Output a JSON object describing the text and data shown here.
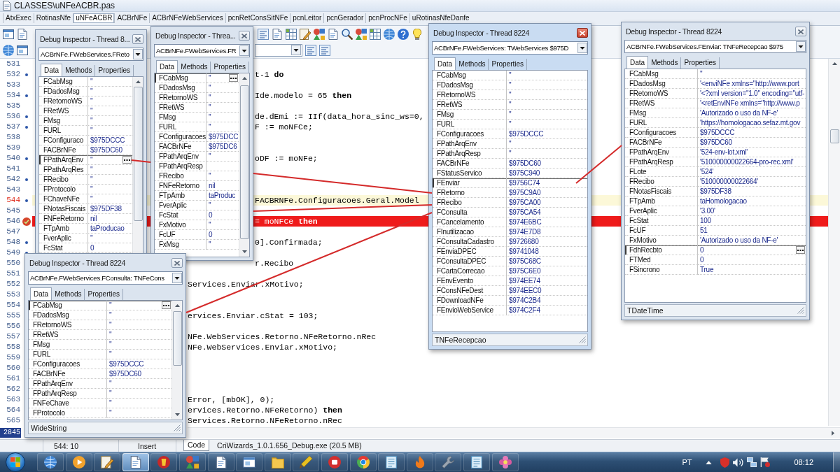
{
  "window": {
    "title": "CLASSES\\uNFeACBR.pas"
  },
  "file_tabs": [
    {
      "label": "AtxExec",
      "selected": false
    },
    {
      "label": "RotinasNfe",
      "selected": false
    },
    {
      "label": "uNFeACBR",
      "selected": true
    },
    {
      "label": "ACBrNFe",
      "selected": false
    },
    {
      "label": "ACBrNFeWebServices",
      "selected": false
    },
    {
      "label": "pcnRetConsSitNFe",
      "selected": false
    },
    {
      "label": "pcnLeitor",
      "selected": false
    },
    {
      "label": "pcnGerador",
      "selected": false
    },
    {
      "label": "pcnProcNFe",
      "selected": false
    },
    {
      "label": "uRotinasNfeDanfe",
      "selected": false
    }
  ],
  "editor": {
    "lines": [
      {
        "number": "531",
        "executable": false,
        "breakpoint": false,
        "current": false
      },
      {
        "number": "532",
        "executable": true,
        "breakpoint": false,
        "current": false,
        "text": "t-1 **do**"
      },
      {
        "number": "533",
        "executable": false,
        "breakpoint": false,
        "current": false
      },
      {
        "number": "534",
        "executable": true,
        "breakpoint": false,
        "current": false,
        "text": "Ide.modelo = 65 **then**"
      },
      {
        "number": "535",
        "executable": false,
        "breakpoint": false,
        "current": false
      },
      {
        "number": "536",
        "executable": true,
        "breakpoint": false,
        "current": false,
        "text": "de.dEmi := IIf(data_hora_sinc_ws=0,"
      },
      {
        "number": "537",
        "executable": true,
        "breakpoint": false,
        "current": false,
        "text": "F := moNFCe;"
      },
      {
        "number": "538",
        "executable": false,
        "breakpoint": false,
        "current": false
      },
      {
        "number": "539",
        "executable": false,
        "breakpoint": false,
        "current": false
      },
      {
        "number": "540",
        "executable": true,
        "breakpoint": false,
        "current": false,
        "text": "oDF := moNFe;"
      },
      {
        "number": "541",
        "executable": false,
        "breakpoint": false,
        "current": false
      },
      {
        "number": "542",
        "executable": true,
        "breakpoint": false,
        "current": false
      },
      {
        "number": "543",
        "executable": false,
        "breakpoint": false,
        "current": false
      },
      {
        "number": "544",
        "executable": true,
        "breakpoint": false,
        "current": true,
        "text": "FACBRNFe.Configuracoes.Geral.Model"
      },
      {
        "number": "545",
        "executable": false,
        "breakpoint": false,
        "current": false
      },
      {
        "number": "546",
        "executable": false,
        "breakpoint": true,
        "current": false,
        "text": "= moNFCe **then**"
      },
      {
        "number": "547",
        "executable": false,
        "breakpoint": false,
        "current": false
      },
      {
        "number": "548",
        "executable": true,
        "breakpoint": false,
        "current": false,
        "text": "0].Confirmada;"
      },
      {
        "number": "549",
        "executable": true,
        "breakpoint": false,
        "current": false
      },
      {
        "number": "550",
        "executable": false,
        "breakpoint": false,
        "current": false,
        "text": "r.Recibo"
      },
      {
        "number": "551",
        "executable": false,
        "breakpoint": false,
        "current": false
      },
      {
        "number": "552",
        "executable": false,
        "breakpoint": false,
        "current": false,
        "text": "Services.Enviar.xMotivo;"
      },
      {
        "number": "553",
        "executable": false,
        "breakpoint": false,
        "current": false
      },
      {
        "number": "554",
        "executable": false,
        "breakpoint": false,
        "current": false
      },
      {
        "number": "555",
        "executable": false,
        "breakpoint": false,
        "current": false,
        "text": "ervices.Enviar.cStat = 103;"
      },
      {
        "number": "556",
        "executable": false,
        "breakpoint": false,
        "current": false
      },
      {
        "number": "557",
        "executable": false,
        "breakpoint": false,
        "current": false,
        "text": "NFe.WebServices.Retorno.NFeRetorno.nRec"
      },
      {
        "number": "558",
        "executable": false,
        "breakpoint": false,
        "current": false,
        "text": "NFe.WebServices.Enviar.xMotivo;"
      },
      {
        "number": "559",
        "executable": false,
        "breakpoint": false,
        "current": false
      },
      {
        "number": "560",
        "executable": false,
        "breakpoint": false,
        "current": false
      },
      {
        "number": "561",
        "executable": false,
        "breakpoint": false,
        "current": false
      },
      {
        "number": "562",
        "executable": false,
        "breakpoint": false,
        "current": false
      },
      {
        "number": "563",
        "executable": false,
        "breakpoint": false,
        "current": false,
        "text": "Error, [mbOK], 0);"
      },
      {
        "number": "564",
        "executable": false,
        "breakpoint": false,
        "current": false,
        "text": "ervices.Retorno.NFeRetorno) **then**"
      },
      {
        "number": "565",
        "executable": false,
        "breakpoint": false,
        "current": false,
        "text": "Services.Retorno.NFeRetorno.nRec"
      }
    ],
    "line_badge": "2845"
  },
  "inspectors": [
    {
      "title": "Debug Inspector - Thread 8...",
      "active": false,
      "object": "ACBrNFe.FWebServices.FReto",
      "tabs": [
        {
          "label": "Data",
          "selected": true
        },
        {
          "label": "Methods",
          "selected": false
        },
        {
          "label": "Properties",
          "selected": false
        }
      ],
      "scrollable": true,
      "row_button": true,
      "rows": [
        {
          "name": "FCabMsg",
          "value": "''",
          "selected": false
        },
        {
          "name": "FDadosMsg",
          "value": "''",
          "selected": false
        },
        {
          "name": "FRetornoWS",
          "value": "''",
          "selected": false
        },
        {
          "name": "FRetWS",
          "value": "''",
          "selected": false
        },
        {
          "name": "FMsg",
          "value": "''",
          "selected": false
        },
        {
          "name": "FURL",
          "value": "''",
          "selected": false
        },
        {
          "name": "FConfiguraco",
          "value": "$975DCCC",
          "selected": false
        },
        {
          "name": "FACBrNFe",
          "value": "$975DC60",
          "selected": false
        },
        {
          "name": "FPathArqEnv",
          "value": "''",
          "selected": true
        },
        {
          "name": "FPathArqRes",
          "value": "''",
          "selected": false
        },
        {
          "name": "FRecibo",
          "value": "''",
          "selected": false
        },
        {
          "name": "FProtocolo",
          "value": "''",
          "selected": false
        },
        {
          "name": "FChaveNFe",
          "value": "''",
          "selected": false
        },
        {
          "name": "FNotasFiscais",
          "value": "$975DF38",
          "selected": false
        },
        {
          "name": "FNFeRetorno",
          "value": "nil",
          "selected": false
        },
        {
          "name": "FTpAmb",
          "value": "taProducao",
          "selected": false
        },
        {
          "name": "FverAplic",
          "value": "''",
          "selected": false
        },
        {
          "name": "FcStat",
          "value": "0",
          "selected": false
        }
      ]
    },
    {
      "title": "Debug Inspector - Threa...",
      "active": false,
      "object": "ACBrNFe.FWebServices.FR",
      "tabs": [
        {
          "label": "Data",
          "selected": true
        },
        {
          "label": "Methods",
          "selected": false
        },
        {
          "label": "Properties",
          "selected": false
        }
      ],
      "scrollable": true,
      "row_button": true,
      "rows": [
        {
          "name": "FCabMsg",
          "value": "''",
          "selected": true
        },
        {
          "name": "FDadosMsg",
          "value": "''",
          "selected": false
        },
        {
          "name": "FRetornoWS",
          "value": "''",
          "selected": false
        },
        {
          "name": "FRetWS",
          "value": "''",
          "selected": false
        },
        {
          "name": "FMsg",
          "value": "''",
          "selected": false
        },
        {
          "name": "FURL",
          "value": "''",
          "selected": false
        },
        {
          "name": "FConfiguracoes",
          "value": "$975DCC",
          "selected": false
        },
        {
          "name": "FACBrNFe",
          "value": "$975DC6",
          "selected": false
        },
        {
          "name": "FPathArqEnv",
          "value": "''",
          "selected": false
        },
        {
          "name": "FPathArqResp",
          "selected": false
        },
        {
          "name": "FRecibo",
          "value": "''",
          "selected": false
        },
        {
          "name": "FNFeRetorno",
          "value": "nil",
          "selected": false
        },
        {
          "name": "FTpAmb",
          "value": "taProduc",
          "selected": false
        },
        {
          "name": "FverAplic",
          "value": "''",
          "selected": false
        },
        {
          "name": "FcStat",
          "value": "0",
          "selected": false
        },
        {
          "name": "FxMotivo",
          "value": "''",
          "selected": false
        },
        {
          "name": "FcUF",
          "value": "0",
          "selected": false
        },
        {
          "name": "FxMsg",
          "value": "''",
          "selected": false
        }
      ]
    },
    {
      "title": "Debug Inspector - Thread 8224",
      "active": false,
      "object": "ACBrNFe.FWebServices.FConsulta: TNFeCons",
      "tabs": [
        {
          "label": "Data",
          "selected": true
        },
        {
          "label": "Methods",
          "selected": false
        },
        {
          "label": "Properties",
          "selected": false
        }
      ],
      "scrollable": true,
      "row_button": true,
      "rows": [
        {
          "name": "FCabMsg",
          "value": "''",
          "selected": true
        },
        {
          "name": "FDadosMsg",
          "value": "''",
          "selected": false
        },
        {
          "name": "FRetornoWS",
          "value": "''",
          "selected": false
        },
        {
          "name": "FRetWS",
          "value": "''",
          "selected": false
        },
        {
          "name": "FMsg",
          "value": "''",
          "selected": false
        },
        {
          "name": "FURL",
          "value": "''",
          "selected": false
        },
        {
          "name": "FConfiguracoes",
          "value": "$975DCCC",
          "selected": false
        },
        {
          "name": "FACBrNFe",
          "value": "$975DC60",
          "selected": false
        },
        {
          "name": "FPathArqEnv",
          "value": "''",
          "selected": false
        },
        {
          "name": "FPathArqResp",
          "value": "''",
          "selected": false
        },
        {
          "name": "FNFeChave",
          "value": "''",
          "selected": false
        },
        {
          "name": "FProtocolo",
          "value": "''",
          "selected": false
        }
      ],
      "status": "WideString"
    },
    {
      "title": "Debug Inspector - Thread 8224",
      "active": true,
      "object": "ACBrNFe.FWebServices: TWebServices $975D",
      "tabs": [
        {
          "label": "Data",
          "selected": true
        },
        {
          "label": "Methods",
          "selected": false
        },
        {
          "label": "Properties",
          "selected": false
        }
      ],
      "scrollable": false,
      "row_button": false,
      "rows": [
        {
          "name": "FCabMsg",
          "value": "''",
          "selected": false
        },
        {
          "name": "FDadosMsg",
          "value": "''",
          "selected": false
        },
        {
          "name": "FRetornoWS",
          "value": "''",
          "selected": false
        },
        {
          "name": "FRetWS",
          "value": "''",
          "selected": false
        },
        {
          "name": "FMsg",
          "value": "''",
          "selected": false
        },
        {
          "name": "FURL",
          "value": "''",
          "selected": false
        },
        {
          "name": "FConfiguracoes",
          "value": "$975DCCC",
          "selected": false
        },
        {
          "name": "FPathArqEnv",
          "value": "''",
          "selected": false
        },
        {
          "name": "FPathArqResp",
          "value": "''",
          "selected": false
        },
        {
          "name": "FACBrNFe",
          "value": "$975DC60",
          "selected": false
        },
        {
          "name": "FStatusServico",
          "value": "$975C940",
          "selected": false
        },
        {
          "name": "FEnviar",
          "value": "$9756C74",
          "selected": true
        },
        {
          "name": "FRetorno",
          "value": "$975C9A0",
          "selected": false
        },
        {
          "name": "FRecibo",
          "value": "$975CA00",
          "selected": false
        },
        {
          "name": "FConsulta",
          "value": "$975CA54",
          "selected": false
        },
        {
          "name": "FCancelamento",
          "value": "$974E6BC",
          "selected": false
        },
        {
          "name": "FInutilizacao",
          "value": "$974E7D8",
          "selected": false
        },
        {
          "name": "FConsultaCadastro",
          "value": "$9726680",
          "selected": false
        },
        {
          "name": "FEnviaDPEC",
          "value": "$9741048",
          "selected": false
        },
        {
          "name": "FConsultaDPEC",
          "value": "$975C68C",
          "selected": false
        },
        {
          "name": "FCartaCorrecao",
          "value": "$975C6E0",
          "selected": false
        },
        {
          "name": "FEnvEvento",
          "value": "$974EE74",
          "selected": false
        },
        {
          "name": "FConsNFeDest",
          "value": "$974EEC0",
          "selected": false
        },
        {
          "name": "FDownloadNFe",
          "value": "$974C2B4",
          "selected": false
        },
        {
          "name": "FEnvioWebService",
          "value": "$974C2F4",
          "selected": false
        }
      ],
      "status": "TNFeRecepcao"
    },
    {
      "title": "Debug Inspector - Thread 8224",
      "active": false,
      "object": "ACBrNFe.FWebServices.FEnviar: TNFeRecepcao $975",
      "tabs": [
        {
          "label": "Data",
          "selected": true
        },
        {
          "label": "Methods",
          "selected": false
        },
        {
          "label": "Properties",
          "selected": false
        }
      ],
      "scrollable": false,
      "row_button": true,
      "rows": [
        {
          "name": "FCabMsg",
          "value": "''",
          "selected": false
        },
        {
          "name": "FDadosMsg",
          "value": "'<enviNFe xmlns=\"http://www.port",
          "selected": false
        },
        {
          "name": "FRetornoWS",
          "value": "'<?xml version=\"1.0\" encoding=\"utf-",
          "selected": false
        },
        {
          "name": "FRetWS",
          "value": "'<retEnviNFe xmlns=\"http://www.p",
          "selected": false
        },
        {
          "name": "FMsg",
          "value": "'Autorizado o uso da NF-e'",
          "selected": false
        },
        {
          "name": "FURL",
          "value": "'https://homologacao.sefaz.mt.gov",
          "selected": false
        },
        {
          "name": "FConfiguracoes",
          "value": "$975DCCC",
          "selected": false
        },
        {
          "name": "FACBrNFe",
          "value": "$975DC60",
          "selected": false
        },
        {
          "name": "FPathArqEnv",
          "value": "'524-env-lot.xml'",
          "selected": false
        },
        {
          "name": "FPathArqResp",
          "value": "'510000000022664-pro-rec.xml'",
          "selected": false
        },
        {
          "name": "FLote",
          "value": "'524'",
          "selected": false
        },
        {
          "name": "FRecibo",
          "value": "'510000000022664'",
          "selected": false
        },
        {
          "name": "FNotasFiscais",
          "value": "$975DF38",
          "selected": false
        },
        {
          "name": "FTpAmb",
          "value": "taHomologacao",
          "selected": false
        },
        {
          "name": "FverAplic",
          "value": "'3.00'",
          "selected": false
        },
        {
          "name": "FcStat",
          "value": "100",
          "selected": false
        },
        {
          "name": "FcUF",
          "value": "51",
          "selected": false
        },
        {
          "name": "FxMotivo",
          "value": "'Autorizado o uso da NF-e'",
          "selected": false
        },
        {
          "name": "FdhRecbto",
          "value": "0",
          "selected": true
        },
        {
          "name": "FTMed",
          "value": "0",
          "selected": false
        },
        {
          "name": "FSincrono",
          "value": "True",
          "selected": false
        }
      ],
      "status": "TDateTime"
    }
  ],
  "status_bar": {
    "position": "544: 10",
    "mode": "Insert",
    "tabs": [
      {
        "label": "Code",
        "selected": true
      },
      {
        "label": "CriWizards_1.0.1.656_Debug.exe (20.5 MB)",
        "selected": false
      }
    ]
  },
  "taskbar": {
    "items": [
      {
        "selected": false
      },
      {
        "selected": false
      },
      {
        "selected": false
      },
      {
        "selected": true
      },
      {
        "selected": false
      },
      {
        "selected": false
      },
      {
        "selected": false
      },
      {
        "selected": false
      },
      {
        "selected": false
      },
      {
        "selected": false
      },
      {
        "selected": false
      },
      {
        "selected": false
      },
      {
        "selected": false
      },
      {
        "selected": false
      },
      {
        "selected": false
      },
      {
        "selected": false
      },
      {
        "selected": false
      }
    ],
    "language": "PT",
    "clock": "08:12"
  }
}
